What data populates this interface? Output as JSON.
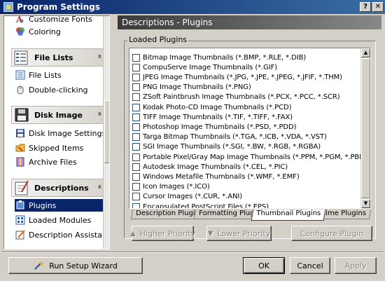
{
  "window": {
    "title": "Program Settings",
    "help_button": "?",
    "close_button": "✕"
  },
  "sidebar": {
    "top_items": [
      {
        "label": "Customize Fonts",
        "icon": "font-icon"
      },
      {
        "label": "Coloring",
        "icon": "color-palette-icon"
      }
    ],
    "groups": [
      {
        "header": "File Lists",
        "icon": "file-lists-icon",
        "items": [
          {
            "label": "File Lists",
            "icon": "list-view-icon"
          },
          {
            "label": "Double-clicking",
            "icon": "mouse-icon"
          }
        ]
      },
      {
        "header": "Disk Image",
        "icon": "disk-image-icon",
        "items": [
          {
            "label": "Disk Image Settings",
            "icon": "disk-settings-icon"
          },
          {
            "label": "Skipped Items",
            "icon": "skipped-items-icon"
          },
          {
            "label": "Archive Files",
            "icon": "archive-icon"
          }
        ]
      },
      {
        "header": "Descriptions",
        "icon": "descriptions-icon",
        "items": [
          {
            "label": "Plugins",
            "icon": "plugin-icon",
            "selected": true
          },
          {
            "label": "Loaded Modules",
            "icon": "modules-icon"
          },
          {
            "label": "Description Assistant",
            "icon": "assistant-icon"
          }
        ]
      }
    ],
    "collapse_glyph": "«"
  },
  "content": {
    "header": "Descriptions - Plugins",
    "groupbox_label": "Loaded Plugins",
    "plugins": [
      {
        "label": "Bitmap Image Thumbnails (*.BMP, *.RLE, *.DIB)",
        "checked": false
      },
      {
        "label": "CompuServe Image Thumbnails (*.GIF)",
        "checked": false
      },
      {
        "label": "JPEG Image Thumbnails (*.JPG, *.JPE, *.JPEG, *.JFIF, *.THM)",
        "checked": false
      },
      {
        "label": "PNG Image Thumbnails (*.PNG)",
        "checked": false
      },
      {
        "label": "ZSoft Paintbrush Image Thumbnails (*.PCX, *.PCC, *.SCR)",
        "checked": false
      },
      {
        "label": "Kodak Photo-CD Image Thumbnails (*.PCD)",
        "checked": false
      },
      {
        "label": "TIFF Image Thumbnails (*.TIF, *.TIFF, *.FAX)",
        "checked": false
      },
      {
        "label": "Photoshop Image Thumbnails (*.PSD, *.PDD)",
        "checked": false
      },
      {
        "label": "Targa Bitmap Thumbnails (*.TGA, *.ICB, *.VDA, *.VST)",
        "checked": false
      },
      {
        "label": "SGI Image Thumbnails (*.SGI, *.BW, *.RGB, *.RGBA)",
        "checked": false
      },
      {
        "label": "Portable Pixel/Gray Map Image Thumbnails (*.PPM, *.PGM, *.PBM)",
        "checked": false
      },
      {
        "label": "Autodesk Image Thumbnails (*.CEL, *.PIC)",
        "checked": false
      },
      {
        "label": "Windows Metafile Thumbnails (*.WMF, *.EMF)",
        "checked": false
      },
      {
        "label": "Icon Images (*.ICO)",
        "checked": false
      },
      {
        "label": "Cursor Images (*.CUR, *.ANI)",
        "checked": false
      },
      {
        "label": "Encapsulated PostScript Files (*.EPS)",
        "checked": false
      }
    ],
    "tabs": [
      {
        "label": "Description Plugins",
        "active": false
      },
      {
        "label": "Formatting Plugins",
        "active": false
      },
      {
        "label": "Thumbnail Plugins",
        "active": true
      },
      {
        "label": "Runtime Plugins",
        "active": false
      }
    ],
    "actions": {
      "higher_priority": "Higher Priority",
      "lower_priority": "Lower Priority",
      "configure_plugin": "Configure Plugin"
    }
  },
  "footer": {
    "setup_wizard": "Run Setup Wizard",
    "ok": "OK",
    "cancel": "Cancel",
    "apply": "Apply"
  },
  "colors": {
    "title_gradient_start": "#0a246a",
    "title_gradient_end": "#3a6ea5",
    "selection": "#0a246a",
    "face": "#d4d0c8"
  }
}
